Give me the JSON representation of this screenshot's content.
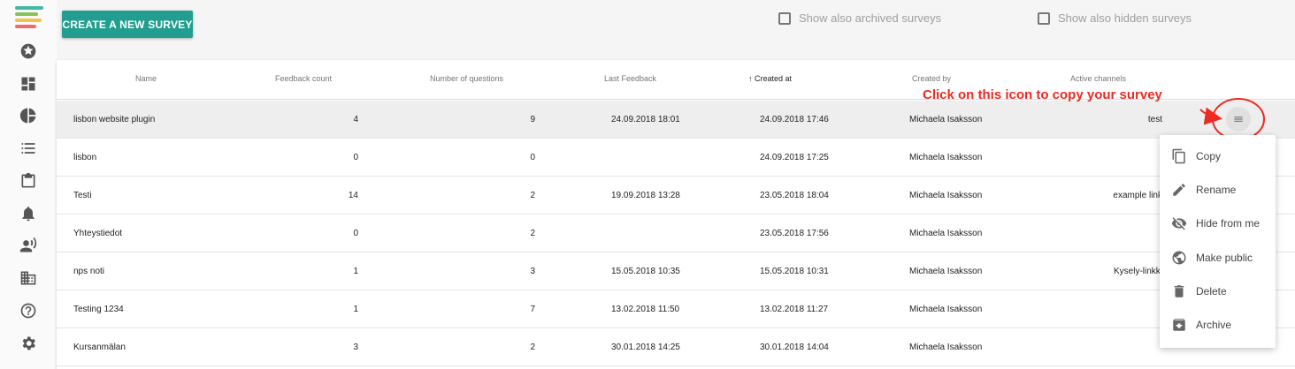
{
  "toolbar": {
    "create_label": "CREATE A NEW SURVEY",
    "archived_label": "Show also archived surveys",
    "hidden_label": "Show also hidden surveys",
    "archived_checked": false,
    "hidden_checked": false
  },
  "sidebar": {
    "logo_colors": [
      "#43b8a3",
      "#86c35a",
      "#f2c14e",
      "#ef6b6b"
    ],
    "items": [
      {
        "icon": "star-icon"
      },
      {
        "icon": "dashboard-icon"
      },
      {
        "icon": "pie-chart-icon"
      },
      {
        "icon": "list-icon"
      },
      {
        "icon": "clipboard-icon"
      },
      {
        "icon": "bell-icon"
      },
      {
        "icon": "person-voice-icon"
      },
      {
        "icon": "building-icon"
      },
      {
        "icon": "help-icon"
      },
      {
        "icon": "settings-icon"
      }
    ]
  },
  "table": {
    "headers": {
      "name": "Name",
      "feedback_count": "Feedback count",
      "num_questions": "Number of questions",
      "last_feedback": "Last Feedback",
      "created_at": "Created at",
      "created_by": "Created by",
      "active_channels": "Active channels"
    },
    "sort_icon": "↑",
    "rows": [
      {
        "name": "lisbon website plugin",
        "feedback": "4",
        "questions": "9",
        "last": "24.09.2018 18:01",
        "created": "24.09.2018 17:46",
        "by": "Michaela Isaksson",
        "channels": "test"
      },
      {
        "name": "lisbon",
        "feedback": "0",
        "questions": "0",
        "last": "",
        "created": "24.09.2018 17:25",
        "by": "Michaela Isaksson",
        "channels": ""
      },
      {
        "name": "Testi",
        "feedback": "14",
        "questions": "2",
        "last": "19.09.2018 13:28",
        "created": "23.05.2018 18:04",
        "by": "Michaela Isaksson",
        "channels": "example link"
      },
      {
        "name": "Yhteystiedot",
        "feedback": "0",
        "questions": "2",
        "last": "",
        "created": "23.05.2018 17:56",
        "by": "Michaela Isaksson",
        "channels": ""
      },
      {
        "name": "nps noti",
        "feedback": "1",
        "questions": "3",
        "last": "15.05.2018 10:35",
        "created": "15.05.2018 10:31",
        "by": "Michaela Isaksson",
        "channels": "Kysely-linkki"
      },
      {
        "name": "Testing 1234",
        "feedback": "1",
        "questions": "7",
        "last": "13.02.2018 11:50",
        "created": "13.02.2018 11:27",
        "by": "Michaela Isaksson",
        "channels": ""
      },
      {
        "name": "Kursanmälan",
        "feedback": "3",
        "questions": "2",
        "last": "30.01.2018 14:25",
        "created": "30.01.2018 14:04",
        "by": "Michaela Isaksson",
        "channels": ""
      }
    ]
  },
  "annotation": {
    "text": "Click on this icon to copy your survey",
    "color": "#ee2a21"
  },
  "menu": {
    "items": [
      {
        "label": "Copy",
        "icon": "copy-icon"
      },
      {
        "label": "Rename",
        "icon": "pencil-icon"
      },
      {
        "label": "Hide from me",
        "icon": "eye-off-icon"
      },
      {
        "label": "Make public",
        "icon": "globe-icon"
      },
      {
        "label": "Delete",
        "icon": "trash-icon"
      },
      {
        "label": "Archive",
        "icon": "archive-icon"
      }
    ]
  },
  "colors": {
    "accent": "#219e8f"
  }
}
